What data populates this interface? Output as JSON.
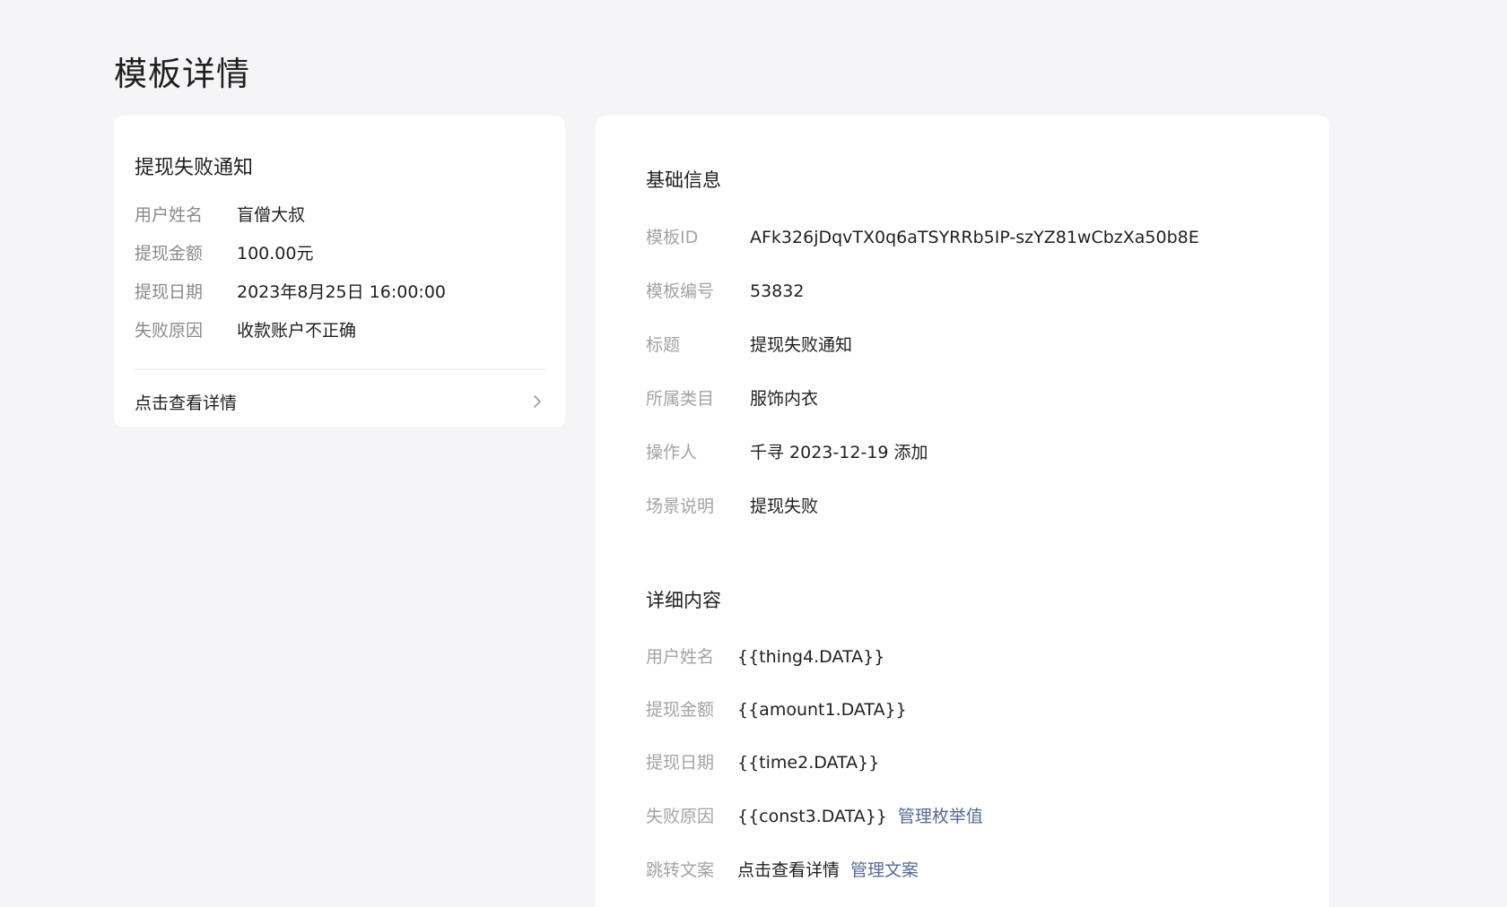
{
  "page_title": "模板详情",
  "preview": {
    "title": "提现失败通知",
    "fields": [
      {
        "label": "用户姓名",
        "value": "盲僧大叔"
      },
      {
        "label": "提现金额",
        "value": "100.00元"
      },
      {
        "label": "提现日期",
        "value": "2023年8月25日 16:00:00"
      },
      {
        "label": "失败原因",
        "value": "收款账户不正确"
      }
    ],
    "detail_link": "点击查看详情",
    "detail_icon": "chevron-right-icon"
  },
  "basic_info": {
    "section_title": "基础信息",
    "rows": [
      {
        "label": "模板ID",
        "value": "AFk326jDqvTX0q6aTSYRRb5IP-szYZ81wCbzXa50b8E"
      },
      {
        "label": "模板编号",
        "value": "53832"
      },
      {
        "label": "标题",
        "value": "提现失败通知"
      },
      {
        "label": "所属类目",
        "value": "服饰内衣"
      },
      {
        "label": "操作人",
        "value": "千寻 2023-12-19 添加"
      },
      {
        "label": "场景说明",
        "value": "提现失败"
      }
    ]
  },
  "detail_content": {
    "section_title": "详细内容",
    "rows": [
      {
        "label": "用户姓名",
        "value": "{{thing4.DATA}}",
        "link": ""
      },
      {
        "label": "提现金额",
        "value": "{{amount1.DATA}}",
        "link": ""
      },
      {
        "label": "提现日期",
        "value": "{{time2.DATA}}",
        "link": ""
      },
      {
        "label": "失败原因",
        "value": "{{const3.DATA}}",
        "link": "管理枚举值"
      },
      {
        "label": "跳转文案",
        "value": "点击查看详情",
        "link": "管理文案"
      }
    ]
  },
  "colors": {
    "background": "#f5f5f7",
    "card": "#ffffff",
    "link": "#576b95",
    "label": "#a3a3a3",
    "text": "#1f1f1f"
  }
}
